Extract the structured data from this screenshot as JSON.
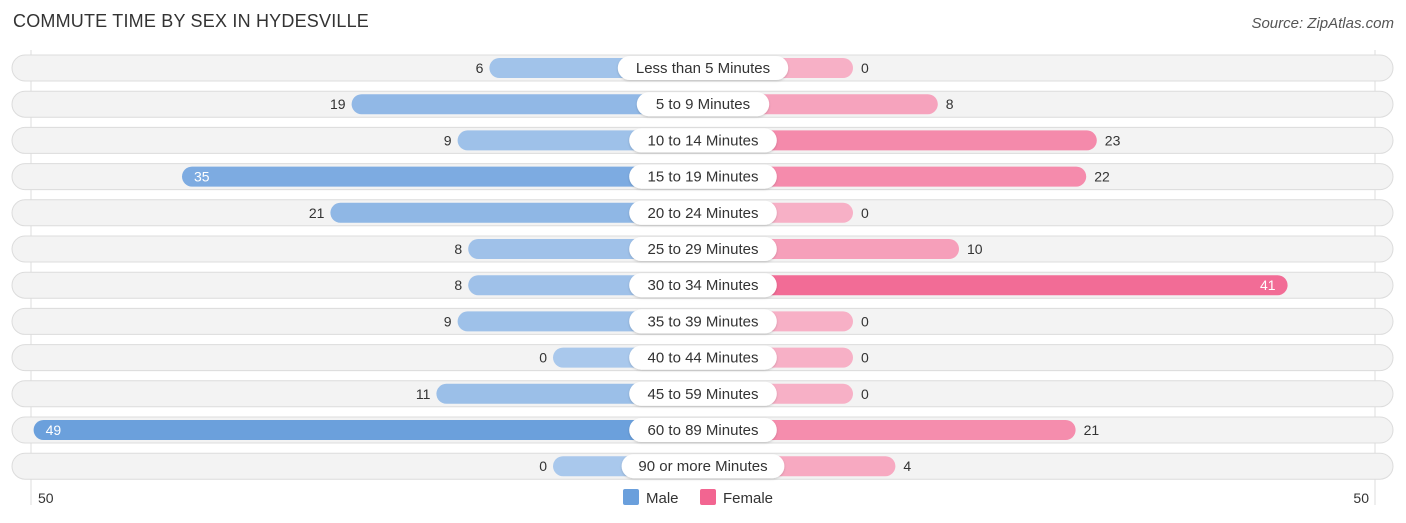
{
  "chart_data": {
    "type": "bar",
    "orientation": "horizontal-diverging",
    "title": "COMMUTE TIME BY SEX IN HYDESVILLE",
    "source": "Source: ZipAtlas.com",
    "categories": [
      "Less than 5 Minutes",
      "5 to 9 Minutes",
      "10 to 14 Minutes",
      "15 to 19 Minutes",
      "20 to 24 Minutes",
      "25 to 29 Minutes",
      "30 to 34 Minutes",
      "35 to 39 Minutes",
      "40 to 44 Minutes",
      "45 to 59 Minutes",
      "60 to 89 Minutes",
      "90 or more Minutes"
    ],
    "series": [
      {
        "name": "Male",
        "color": "#6a9fdc",
        "values": [
          6,
          19,
          9,
          35,
          21,
          8,
          8,
          9,
          0,
          11,
          49,
          0
        ]
      },
      {
        "name": "Female",
        "color": "#f26591",
        "values": [
          0,
          8,
          23,
          22,
          0,
          10,
          41,
          0,
          0,
          0,
          21,
          4
        ]
      }
    ],
    "axis_left_label": "50",
    "axis_right_label": "50",
    "xlim": [
      -50,
      50
    ],
    "legend": {
      "placement": "bottom-center",
      "items": [
        "Male",
        "Female"
      ]
    }
  }
}
